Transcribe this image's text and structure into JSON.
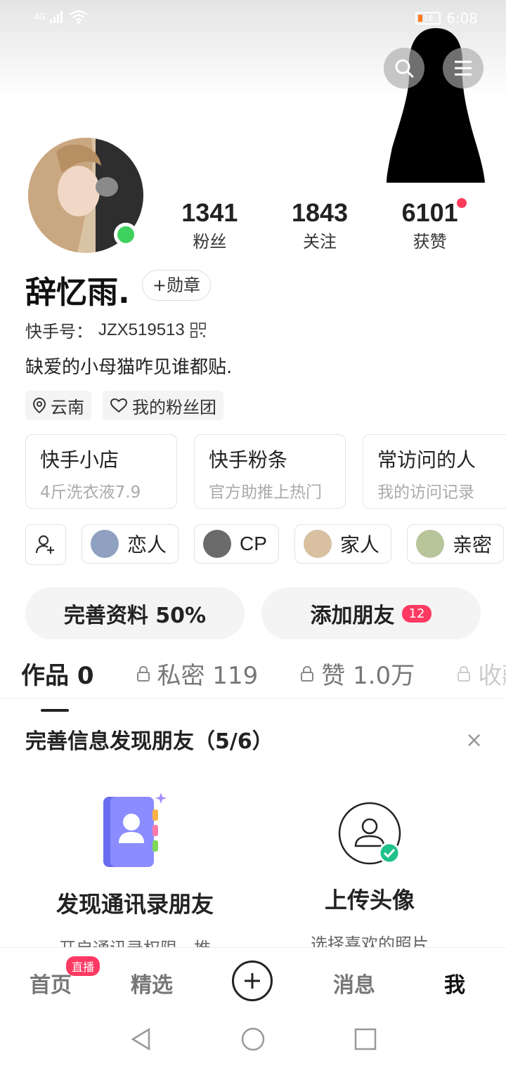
{
  "status_bar": {
    "signal": "4G",
    "battery": "16",
    "time": "6:08"
  },
  "profile": {
    "name": "辞忆雨.",
    "medal_label": "+勋章",
    "id_label": "快手号：",
    "id_value": "JZX519513",
    "bio": "缺爱的小母猫咋见谁都贴.",
    "location": "云南",
    "fans_club": "我的粉丝团"
  },
  "stats": [
    {
      "num": "1341",
      "label": "粉丝"
    },
    {
      "num": "1843",
      "label": "关注"
    },
    {
      "num": "6101",
      "label": "获赞"
    }
  ],
  "cards": [
    {
      "title": "快手小店",
      "sub": "4斤洗衣液7.9"
    },
    {
      "title": "快手粉条",
      "sub": "官方助推上热门"
    },
    {
      "title": "常访问的人",
      "sub": "我的访问记录"
    }
  ],
  "relations": [
    {
      "label": "恋人"
    },
    {
      "label": "CP"
    },
    {
      "label": "家人"
    },
    {
      "label": "亲密"
    }
  ],
  "actions": {
    "complete_profile": "完善资料 50%",
    "add_friends": "添加朋友",
    "add_friends_badge": "12"
  },
  "tabs": [
    {
      "label": "作品 0"
    },
    {
      "label": "私密 119"
    },
    {
      "label": "赞 1.0万"
    },
    {
      "label": "收藏"
    }
  ],
  "discover": {
    "title": "完善信息发现朋友（5/6）",
    "close": "×",
    "items": [
      {
        "title": "发现通讯录朋友",
        "desc": "开启通讯录权限，推"
      },
      {
        "title": "上传头像",
        "desc": "选择喜欢的照片"
      }
    ]
  },
  "bottom_nav": {
    "home": "首页",
    "live_badge": "直播",
    "featured": "精选",
    "messages": "消息",
    "me": "我"
  },
  "colors": {
    "accent": "#fe3a63",
    "online": "#3fd15d"
  }
}
